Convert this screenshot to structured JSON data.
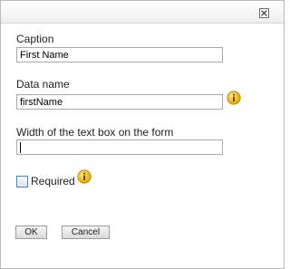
{
  "dialog": {
    "close_glyph": "×",
    "fields": {
      "caption": {
        "label": "Caption",
        "value": "First Name"
      },
      "data_name": {
        "label": "Data name",
        "value": "firstName"
      },
      "width": {
        "label": "Width of the text box on the form",
        "value": ""
      }
    },
    "required": {
      "label": "Required",
      "checked": false
    },
    "buttons": {
      "ok": "OK",
      "cancel": "Cancel"
    },
    "icons": {
      "info": "info-icon",
      "close": "close-icon"
    },
    "colors": {
      "info_icon": "#e8b000",
      "border": "#a9a9a9"
    }
  }
}
